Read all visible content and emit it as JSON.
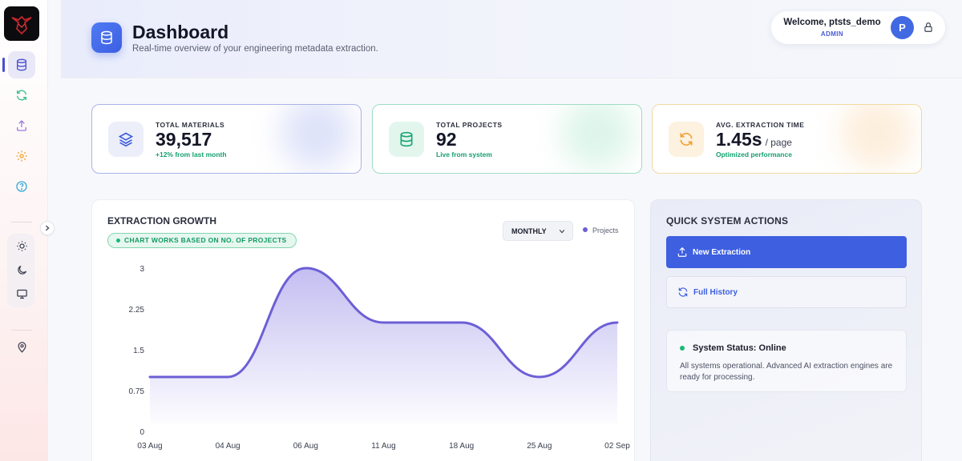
{
  "header": {
    "title": "Dashboard",
    "subtitle": "Real-time overview of your engineering metadata extraction."
  },
  "user": {
    "welcome": "Welcome, ptsts_demo",
    "role": "ADMIN",
    "avatar_initial": "P"
  },
  "sidebar": {
    "items": [
      {
        "icon": "database-icon",
        "active": true
      },
      {
        "icon": "refresh-icon",
        "color": "#3cc08a"
      },
      {
        "icon": "upload-icon",
        "color": "#9b7be0"
      },
      {
        "icon": "gear-icon",
        "color": "#f0a030"
      },
      {
        "icon": "help-icon",
        "color": "#36a9d6"
      }
    ],
    "theme": [
      "sun-icon",
      "moon-icon",
      "monitor-icon"
    ],
    "bottom": [
      "location-pin-icon"
    ]
  },
  "stats": [
    {
      "label": "TOTAL MATERIALS",
      "value": "39,517",
      "unit": "",
      "note": "+12% from last month",
      "icon": "layers-icon"
    },
    {
      "label": "TOTAL PROJECTS",
      "value": "92",
      "unit": "",
      "note": "Live from system",
      "icon": "database-icon"
    },
    {
      "label": "AVG. EXTRACTION TIME",
      "value": "1.45s",
      "unit": "/ page",
      "note": "Optimized performance",
      "icon": "refresh-icon"
    }
  ],
  "chart_panel": {
    "title": "EXTRACTION GROWTH",
    "pill": "CHART WORKS BASED ON NO. OF PROJECTS",
    "period": "MONTHLY"
  },
  "chart_data": {
    "type": "area",
    "x": [
      "03 Aug",
      "04 Aug",
      "06 Aug",
      "11 Aug",
      "18 Aug",
      "25 Aug",
      "02 Sep"
    ],
    "series": [
      {
        "name": "Projects",
        "values": [
          1,
          1,
          3,
          2,
          2,
          1,
          2
        ]
      }
    ],
    "yticks": [
      "0",
      "0.75",
      "1.5",
      "2.25",
      "3"
    ],
    "ylim": [
      0,
      3
    ],
    "legend": "top-right",
    "color": "#6c5fd6"
  },
  "actions": {
    "title": "QUICK SYSTEM ACTIONS",
    "new_extraction": "New Extraction",
    "full_history": "Full History",
    "status_title": "System Status: Online",
    "status_desc": "All systems operational. Advanced AI extraction engines are ready for processing."
  }
}
